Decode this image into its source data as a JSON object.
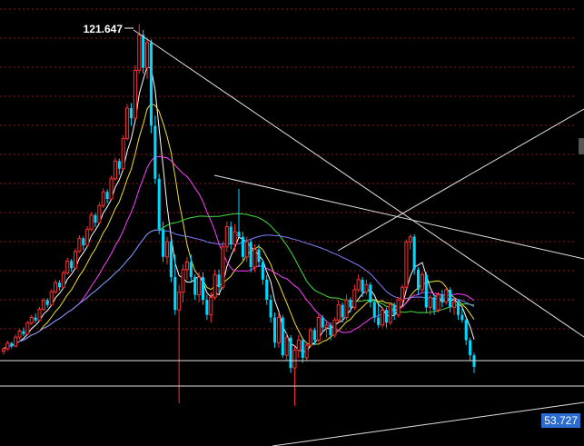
{
  "chart_data": {
    "type": "candlestick",
    "title": "",
    "annotations": {
      "high_label": "121.647",
      "current_price": "53.727"
    },
    "price_range": [
      40,
      125
    ],
    "grid": "horizontal-dotted-red",
    "colors": {
      "up": "#ff3030",
      "down": "#00d8ff",
      "ma5": "#ffffff",
      "ma10": "#f0e030",
      "ma20": "#ff40ff",
      "ma60": "#40e040",
      "ma120": "#8080ff",
      "trend": "#e0e0e0",
      "grid": "#8a1a1a",
      "price_tag_bg": "#2b6cd0"
    },
    "candles": [
      [
        56.8,
        57.6,
        56.2,
        57.3
      ],
      [
        57.3,
        58.9,
        56.9,
        58.4
      ],
      [
        58.4,
        58.7,
        57.4,
        57.8
      ],
      [
        57.8,
        60.1,
        57.6,
        59.6
      ],
      [
        59.6,
        61.2,
        59.1,
        60.8
      ],
      [
        60.8,
        61.5,
        59.8,
        60.2
      ],
      [
        60.2,
        62.8,
        60.0,
        62.4
      ],
      [
        62.4,
        64.0,
        62.0,
        63.5
      ],
      [
        63.5,
        64.3,
        62.5,
        62.9
      ],
      [
        62.9,
        65.6,
        62.7,
        65.1
      ],
      [
        65.1,
        67.4,
        64.8,
        66.9
      ],
      [
        66.9,
        67.3,
        65.5,
        66.0
      ],
      [
        66.0,
        69.1,
        65.8,
        68.6
      ],
      [
        68.6,
        71.0,
        68.2,
        70.4
      ],
      [
        70.4,
        70.9,
        68.9,
        69.5
      ],
      [
        69.5,
        72.8,
        69.2,
        72.3
      ],
      [
        72.3,
        75.3,
        72.0,
        74.7
      ],
      [
        74.7,
        75.1,
        72.6,
        73.3
      ],
      [
        73.3,
        77.2,
        73.0,
        76.6
      ],
      [
        76.6,
        79.8,
        76.3,
        79.2
      ],
      [
        79.2,
        79.6,
        76.9,
        77.8
      ],
      [
        77.8,
        81.6,
        77.5,
        81.0
      ],
      [
        81.0,
        84.4,
        80.6,
        83.8
      ],
      [
        83.8,
        84.2,
        81.4,
        82.3
      ],
      [
        82.3,
        86.3,
        82.1,
        85.7
      ],
      [
        85.7,
        89.1,
        85.2,
        88.4
      ],
      [
        88.4,
        88.9,
        86.1,
        87.0
      ],
      [
        87.0,
        91.6,
        86.8,
        91.0
      ],
      [
        91.0,
        95.2,
        90.6,
        94.5
      ],
      [
        94.5,
        95.0,
        91.8,
        93.0
      ],
      [
        93.0,
        99.7,
        92.7,
        99.0
      ],
      [
        99.0,
        105.8,
        98.6,
        105.0
      ],
      [
        105.0,
        106.0,
        101.5,
        103.0
      ],
      [
        103.0,
        113.5,
        102.8,
        112.5
      ],
      [
        112.5,
        121.647,
        111.8,
        119.5
      ],
      [
        119.5,
        120.5,
        111.8,
        113.0
      ],
      [
        113.0,
        119.0,
        110.8,
        118.0
      ],
      [
        118.0,
        118.6,
        100.0,
        101.5
      ],
      [
        101.5,
        103.5,
        90.0,
        91.0
      ],
      [
        91.0,
        92.0,
        80.0,
        81.0
      ],
      [
        81.0,
        82.5,
        74.5,
        75.5
      ],
      [
        75.5,
        79.5,
        74.0,
        78.5
      ],
      [
        78.5,
        79.0,
        70.5,
        71.5
      ],
      [
        71.5,
        76.0,
        64.0,
        65.0
      ],
      [
        65.0,
        70.0,
        46.5,
        68.5
      ],
      [
        68.5,
        74.0,
        66.5,
        73.0
      ],
      [
        73.0,
        75.5,
        71.0,
        74.5
      ],
      [
        74.5,
        76.0,
        70.5,
        71.5
      ],
      [
        71.5,
        72.0,
        67.0,
        68.0
      ],
      [
        68.0,
        72.5,
        66.5,
        71.5
      ],
      [
        71.5,
        72.5,
        66.0,
        67.0
      ],
      [
        67.0,
        68.0,
        63.0,
        64.0
      ],
      [
        64.0,
        68.5,
        62.5,
        67.5
      ],
      [
        67.5,
        73.0,
        67.0,
        72.0
      ],
      [
        72.0,
        73.0,
        68.5,
        69.5
      ],
      [
        69.5,
        78.5,
        69.0,
        77.5
      ],
      [
        77.5,
        82.5,
        76.5,
        81.5
      ],
      [
        81.5,
        82.5,
        77.0,
        78.0
      ],
      [
        78.0,
        82.0,
        76.5,
        80.5
      ],
      [
        80.5,
        89.0,
        80.0,
        79.5
      ],
      [
        79.5,
        80.5,
        74.5,
        75.5
      ],
      [
        75.5,
        79.5,
        74.5,
        78.5
      ],
      [
        78.5,
        79.0,
        72.5,
        73.5
      ],
      [
        73.5,
        78.0,
        72.5,
        77.0
      ],
      [
        77.0,
        78.0,
        73.5,
        74.5
      ],
      [
        74.5,
        75.0,
        70.0,
        71.0
      ],
      [
        71.0,
        72.0,
        66.0,
        67.0
      ],
      [
        67.0,
        68.0,
        62.5,
        63.5
      ],
      [
        63.5,
        64.5,
        57.5,
        58.5
      ],
      [
        58.5,
        64.5,
        57.5,
        63.5
      ],
      [
        63.5,
        64.0,
        55.5,
        56.0
      ],
      [
        56.0,
        60.5,
        55.0,
        59.5
      ],
      [
        59.5,
        60.0,
        52.5,
        53.5
      ],
      [
        53.5,
        58.0,
        46.0,
        57.0
      ],
      [
        57.0,
        60.0,
        55.5,
        59.0
      ],
      [
        59.0,
        59.5,
        54.5,
        55.5
      ],
      [
        55.5,
        58.5,
        55.0,
        58.0
      ],
      [
        58.0,
        61.5,
        57.5,
        61.0
      ],
      [
        61.0,
        61.5,
        58.0,
        59.0
      ],
      [
        59.0,
        64.0,
        58.5,
        63.5
      ],
      [
        63.5,
        64.0,
        60.5,
        61.5
      ],
      [
        61.5,
        63.0,
        59.5,
        62.0
      ],
      [
        62.0,
        62.5,
        59.0,
        60.0
      ],
      [
        60.0,
        63.5,
        59.5,
        63.0
      ],
      [
        63.0,
        67.0,
        62.5,
        66.0
      ],
      [
        66.0,
        66.5,
        62.5,
        63.5
      ],
      [
        63.5,
        68.0,
        63.0,
        67.0
      ],
      [
        67.0,
        67.5,
        64.5,
        65.5
      ],
      [
        65.5,
        70.0,
        65.0,
        69.0
      ],
      [
        69.0,
        72.0,
        68.5,
        71.0
      ],
      [
        71.0,
        71.5,
        67.5,
        68.5
      ],
      [
        68.5,
        71.0,
        68.0,
        70.0
      ],
      [
        70.0,
        70.5,
        65.5,
        66.5
      ],
      [
        66.5,
        67.0,
        62.5,
        63.5
      ],
      [
        63.5,
        66.0,
        61.5,
        62.0
      ],
      [
        62.0,
        65.5,
        61.5,
        65.0
      ],
      [
        65.0,
        65.5,
        61.5,
        62.5
      ],
      [
        62.5,
        66.5,
        62.0,
        66.0
      ],
      [
        66.0,
        66.5,
        63.0,
        64.0
      ],
      [
        64.0,
        67.5,
        63.5,
        67.0
      ],
      [
        67.0,
        70.0,
        66.5,
        69.5
      ],
      [
        69.5,
        79.0,
        69.0,
        78.5
      ],
      [
        78.5,
        80.0,
        77.0,
        79.5
      ],
      [
        79.5,
        80.0,
        72.0,
        73.0
      ],
      [
        73.0,
        73.5,
        68.0,
        69.0
      ],
      [
        69.0,
        72.5,
        68.5,
        72.0
      ],
      [
        72.0,
        72.5,
        64.5,
        65.5
      ],
      [
        65.5,
        68.0,
        64.0,
        67.5
      ],
      [
        67.5,
        68.0,
        64.0,
        65.0
      ],
      [
        65.0,
        68.5,
        64.5,
        68.0
      ],
      [
        68.0,
        69.0,
        65.5,
        66.5
      ],
      [
        66.5,
        69.5,
        66.0,
        69.0
      ],
      [
        69.0,
        69.5,
        64.5,
        65.5
      ],
      [
        65.5,
        67.5,
        64.0,
        66.5
      ],
      [
        66.5,
        67.0,
        63.0,
        64.0
      ],
      [
        64.0,
        65.5,
        62.5,
        63.0
      ],
      [
        63.0,
        63.5,
        58.0,
        59.0
      ],
      [
        59.0,
        59.5,
        55.0,
        56.0
      ],
      [
        56.0,
        56.5,
        52.5,
        53.727
      ]
    ],
    "lines": [
      [
        [
          147,
          33
        ],
        [
          643,
          371
        ]
      ],
      [
        [
          236,
          193
        ],
        [
          643,
          285
        ]
      ],
      [
        [
          372,
          276
        ],
        [
          643,
          120
        ]
      ],
      [
        [
          0,
          397
        ],
        [
          643,
          397
        ]
      ],
      [
        [
          0,
          425
        ],
        [
          643,
          425
        ]
      ],
      [
        [
          300,
          491
        ],
        [
          643,
          443
        ]
      ]
    ]
  }
}
